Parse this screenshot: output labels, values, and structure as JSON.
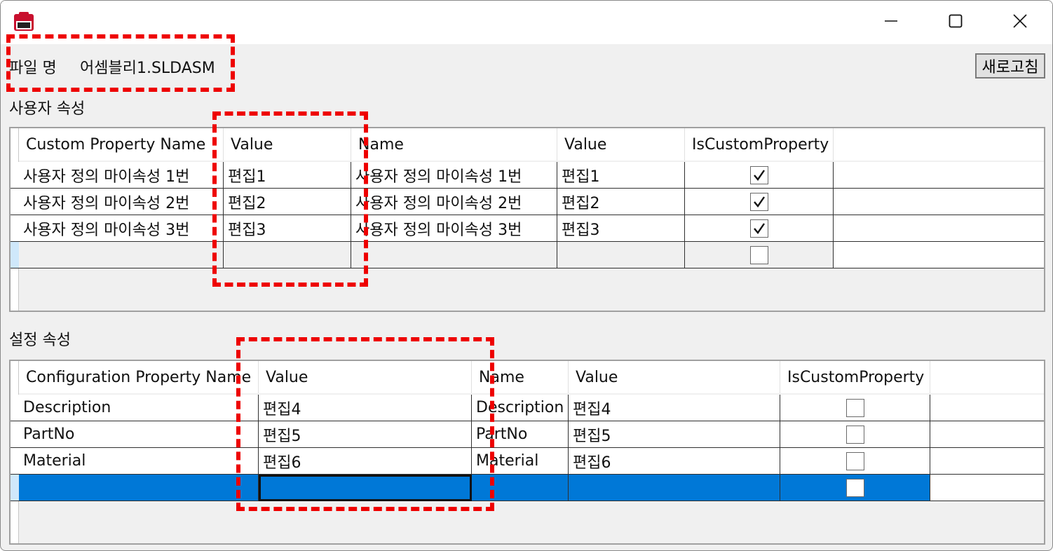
{
  "window": {
    "file_label": "파일 명",
    "file_name": "어셈블리1.SLDASM",
    "refresh_label": "새로고침"
  },
  "custom_section": {
    "label": "사용자 속성",
    "columns": [
      "Custom Property Name",
      "Value",
      "Name",
      "Value",
      "IsCustomProperty"
    ],
    "rows": [
      {
        "prop": "사용자 정의 마이속성 1번",
        "value": "편집1",
        "name": "사용자 정의 마이속성 1번",
        "value2": "편집1",
        "is_custom": true
      },
      {
        "prop": "사용자 정의 마이속성 2번",
        "value": "편집2",
        "name": "사용자 정의 마이속성 2번",
        "value2": "편집2",
        "is_custom": true
      },
      {
        "prop": "사용자 정의 마이속성 3번",
        "value": "편집3",
        "name": "사용자 정의 마이속성 3번",
        "value2": "편집3",
        "is_custom": true
      }
    ]
  },
  "config_section": {
    "label": "설정 속성",
    "columns": [
      "Configuration Property Name",
      "Value",
      "Name",
      "Value",
      "IsCustomProperty"
    ],
    "rows": [
      {
        "prop": "Description",
        "value": "편집4",
        "name": "Description",
        "value2": "편집4",
        "is_custom": false
      },
      {
        "prop": "PartNo",
        "value": "편집5",
        "name": "PartNo",
        "value2": "편집5",
        "is_custom": false
      },
      {
        "prop": "Material",
        "value": "편집6",
        "name": "Material",
        "value2": "편집6",
        "is_custom": false
      }
    ]
  },
  "colors": {
    "selection": "#0078d7",
    "annotation": "#ee0000",
    "button_face": "#e1e1e1",
    "window_bg": "#f0f0f0"
  },
  "icons": {
    "app": "solidworks-2023-app-icon",
    "minimize": "minimize-icon",
    "maximize": "maximize-icon",
    "close": "close-icon",
    "check": "checkmark-icon"
  }
}
